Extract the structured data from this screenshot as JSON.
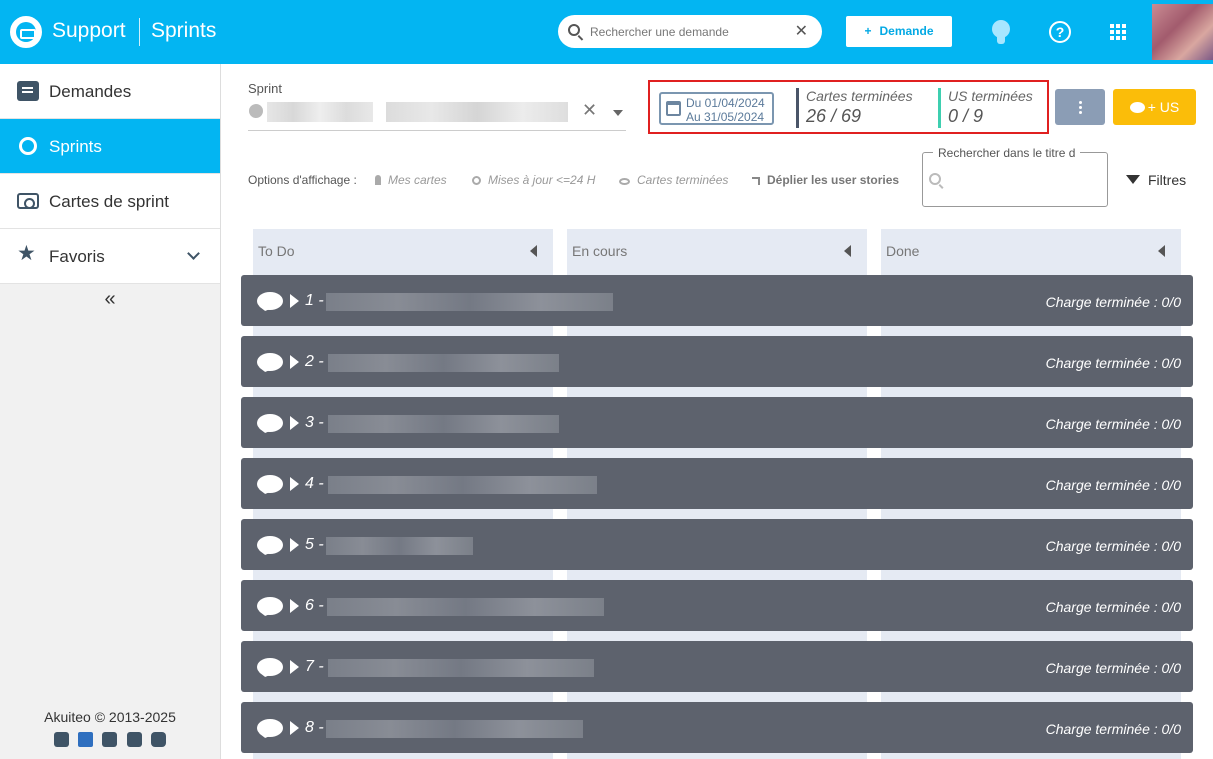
{
  "topbar": {
    "app_name": "Support",
    "section": "Sprints",
    "search_placeholder": "Rechercher une demande",
    "search_clear": "✕",
    "new_request_label": "Demande",
    "new_request_plus": "+",
    "help_glyph": "?",
    "brand_color": "#03b5f2"
  },
  "sidebar": {
    "items": [
      {
        "label": "Demandes",
        "icon": "message-icon",
        "active": false
      },
      {
        "label": "Sprints",
        "icon": "sprint-cycle-icon",
        "active": true
      },
      {
        "label": "Cartes de sprint",
        "icon": "cards-icon",
        "active": false
      },
      {
        "label": "Favoris",
        "icon": "star-icon",
        "active": false
      }
    ],
    "collapse_glyph": "«",
    "copyright": "Akuiteo © 2013-2025",
    "socials": [
      "analytics-icon",
      "bluesky-icon",
      "linkedin-icon",
      "facebook-icon",
      "instagram-icon"
    ]
  },
  "sprint": {
    "label": "Sprint",
    "clear": "✕"
  },
  "stats": {
    "date_from": "Du 01/04/2024",
    "date_to": "Au 31/05/2024",
    "cards_label": "Cartes terminées",
    "cards_value": "26 / 69",
    "us_label": "US terminées",
    "us_value": "0 / 9"
  },
  "actions": {
    "add_us_label": "+ US",
    "accent": "#fbbd09"
  },
  "display_options": {
    "label": "Options d'affichage :",
    "my_cards": "Mes cartes",
    "updated": "Mises à jour <=24 H",
    "done_cards": "Cartes terminées",
    "expand_stories": "Déplier les user stories"
  },
  "title_search": {
    "label": "Rechercher dans le titre d"
  },
  "filters": {
    "label": "Filtres"
  },
  "columns": [
    {
      "title": "To Do"
    },
    {
      "title": "En cours"
    },
    {
      "title": "Done"
    }
  ],
  "stories": [
    {
      "num": "1 -",
      "charge": "Charge terminée : 0/0"
    },
    {
      "num": "2 -",
      "charge": "Charge terminée : 0/0"
    },
    {
      "num": "3 -",
      "charge": "Charge terminée : 0/0"
    },
    {
      "num": "4 -",
      "charge": "Charge terminée : 0/0"
    },
    {
      "num": "5 -",
      "charge": "Charge terminée : 0/0"
    },
    {
      "num": "6 -",
      "charge": "Charge terminée : 0/0"
    },
    {
      "num": "7 -",
      "charge": "Charge terminée : 0/0"
    },
    {
      "num": "8 -",
      "charge": "Charge terminée : 0/0"
    }
  ]
}
